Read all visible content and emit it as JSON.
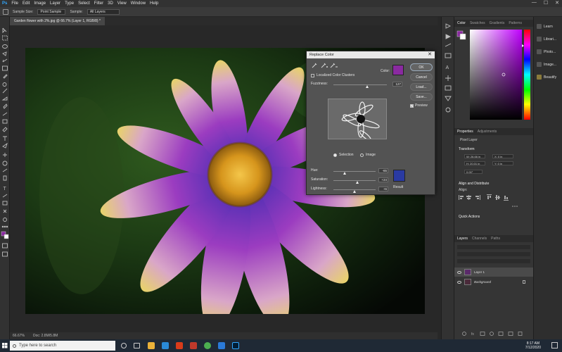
{
  "menu": {
    "ps_logo": "Ps",
    "items": [
      "File",
      "Edit",
      "Image",
      "Layer",
      "Type",
      "Select",
      "Filter",
      "3D",
      "View",
      "Window",
      "Help"
    ],
    "window_controls": [
      "—",
      "☐",
      "✕"
    ]
  },
  "options_bar": {
    "sample_size_label": "Sample Size:",
    "sample_size_value": "Point Sample",
    "sample_label": "Sample:",
    "sample_value": "All Layers"
  },
  "document": {
    "tab_title": "Garden flower with 2%.jpg @ 66.7% (Layer 1, RGB/8) *",
    "zoom": "66.67%",
    "doc_info": "Doc: 2.8M/5.8M"
  },
  "right_panel": {
    "color_tabs": [
      "Color",
      "Swatches",
      "Gradients",
      "Patterns"
    ],
    "properties_tabs": [
      "Properties",
      "Adjustments"
    ],
    "pixel_layer": "Pixel Layer",
    "transform_label": "Transform",
    "fields": [
      "W: 26.66 in",
      "X: 0 in",
      "H: 20.01 in",
      "Y: 0 in",
      "0.00°"
    ],
    "align_label": "Align and Distribute",
    "align_sub": "Align:",
    "quick_actions": "Quick Actions",
    "layers_tabs": [
      "Layers",
      "Channels",
      "Paths"
    ],
    "layers": [
      {
        "name": "Layer 1"
      },
      {
        "name": "Background"
      }
    ]
  },
  "libraries": [
    "Learn",
    "Librari...",
    "Photo...",
    "Image...",
    "Beautify"
  ],
  "dialog": {
    "title": "Replace Color",
    "localized_label": "Localized Color Clusters",
    "color_label": "Color:",
    "fuzziness_label": "Fuzziness:",
    "fuzziness_value": "127",
    "buttons": [
      "OK",
      "Cancel",
      "Load...",
      "Save..."
    ],
    "preview_label": "Preview",
    "selection_label": "Selection",
    "image_label": "Image",
    "hue_label": "Hue:",
    "hue_value": "-65",
    "saturation_label": "Saturation:",
    "saturation_value": "+24",
    "lightness_label": "Lightness:",
    "lightness_value": "+6",
    "result_label": "Result",
    "color_swatch": "#8a2aa0",
    "result_swatch": "#2a3aa2"
  },
  "taskbar": {
    "search_placeholder": "Type here to search",
    "time": "8:17 AM",
    "date": "7/12/2020"
  },
  "colors": {
    "accent": "#1473e6",
    "fg_swatch": "#8a2aa0"
  }
}
